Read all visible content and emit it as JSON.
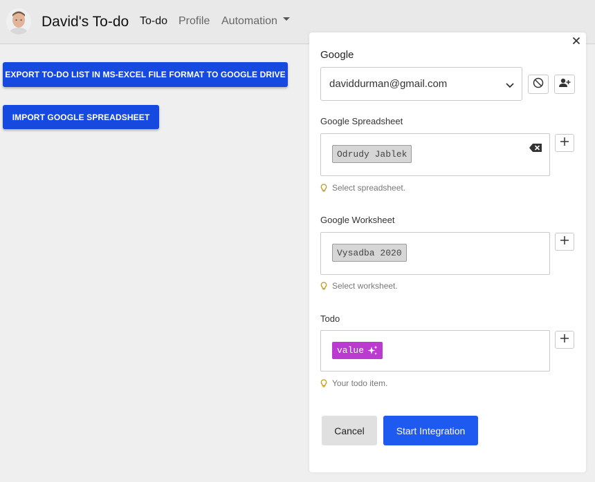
{
  "navbar": {
    "brand": "David's To-do",
    "links": [
      "To-do",
      "Profile",
      "Automation"
    ]
  },
  "actions": {
    "export_label": "EXPORT TO-DO LIST IN MS-EXCEL FILE FORMAT TO GOOGLE DRIVE",
    "import_label": "IMPORT GOOGLE SPREADSHEET"
  },
  "panel": {
    "title": "Google",
    "account": "daviddurman@gmail.com",
    "spreadsheet": {
      "label": "Google Spreadsheet",
      "value": "Odrudy Jablek",
      "hint": "Select spreadsheet."
    },
    "worksheet": {
      "label": "Google Worksheet",
      "value": "Vysadba 2020",
      "hint": "Select worksheet."
    },
    "todo": {
      "label": "Todo",
      "value": "value",
      "hint": "Your todo item."
    },
    "cancel_label": "Cancel",
    "start_label": "Start Integration"
  },
  "colors": {
    "primary": "#1549e0",
    "start": "#1e5af0",
    "value_chip": "#bb3bd0"
  }
}
